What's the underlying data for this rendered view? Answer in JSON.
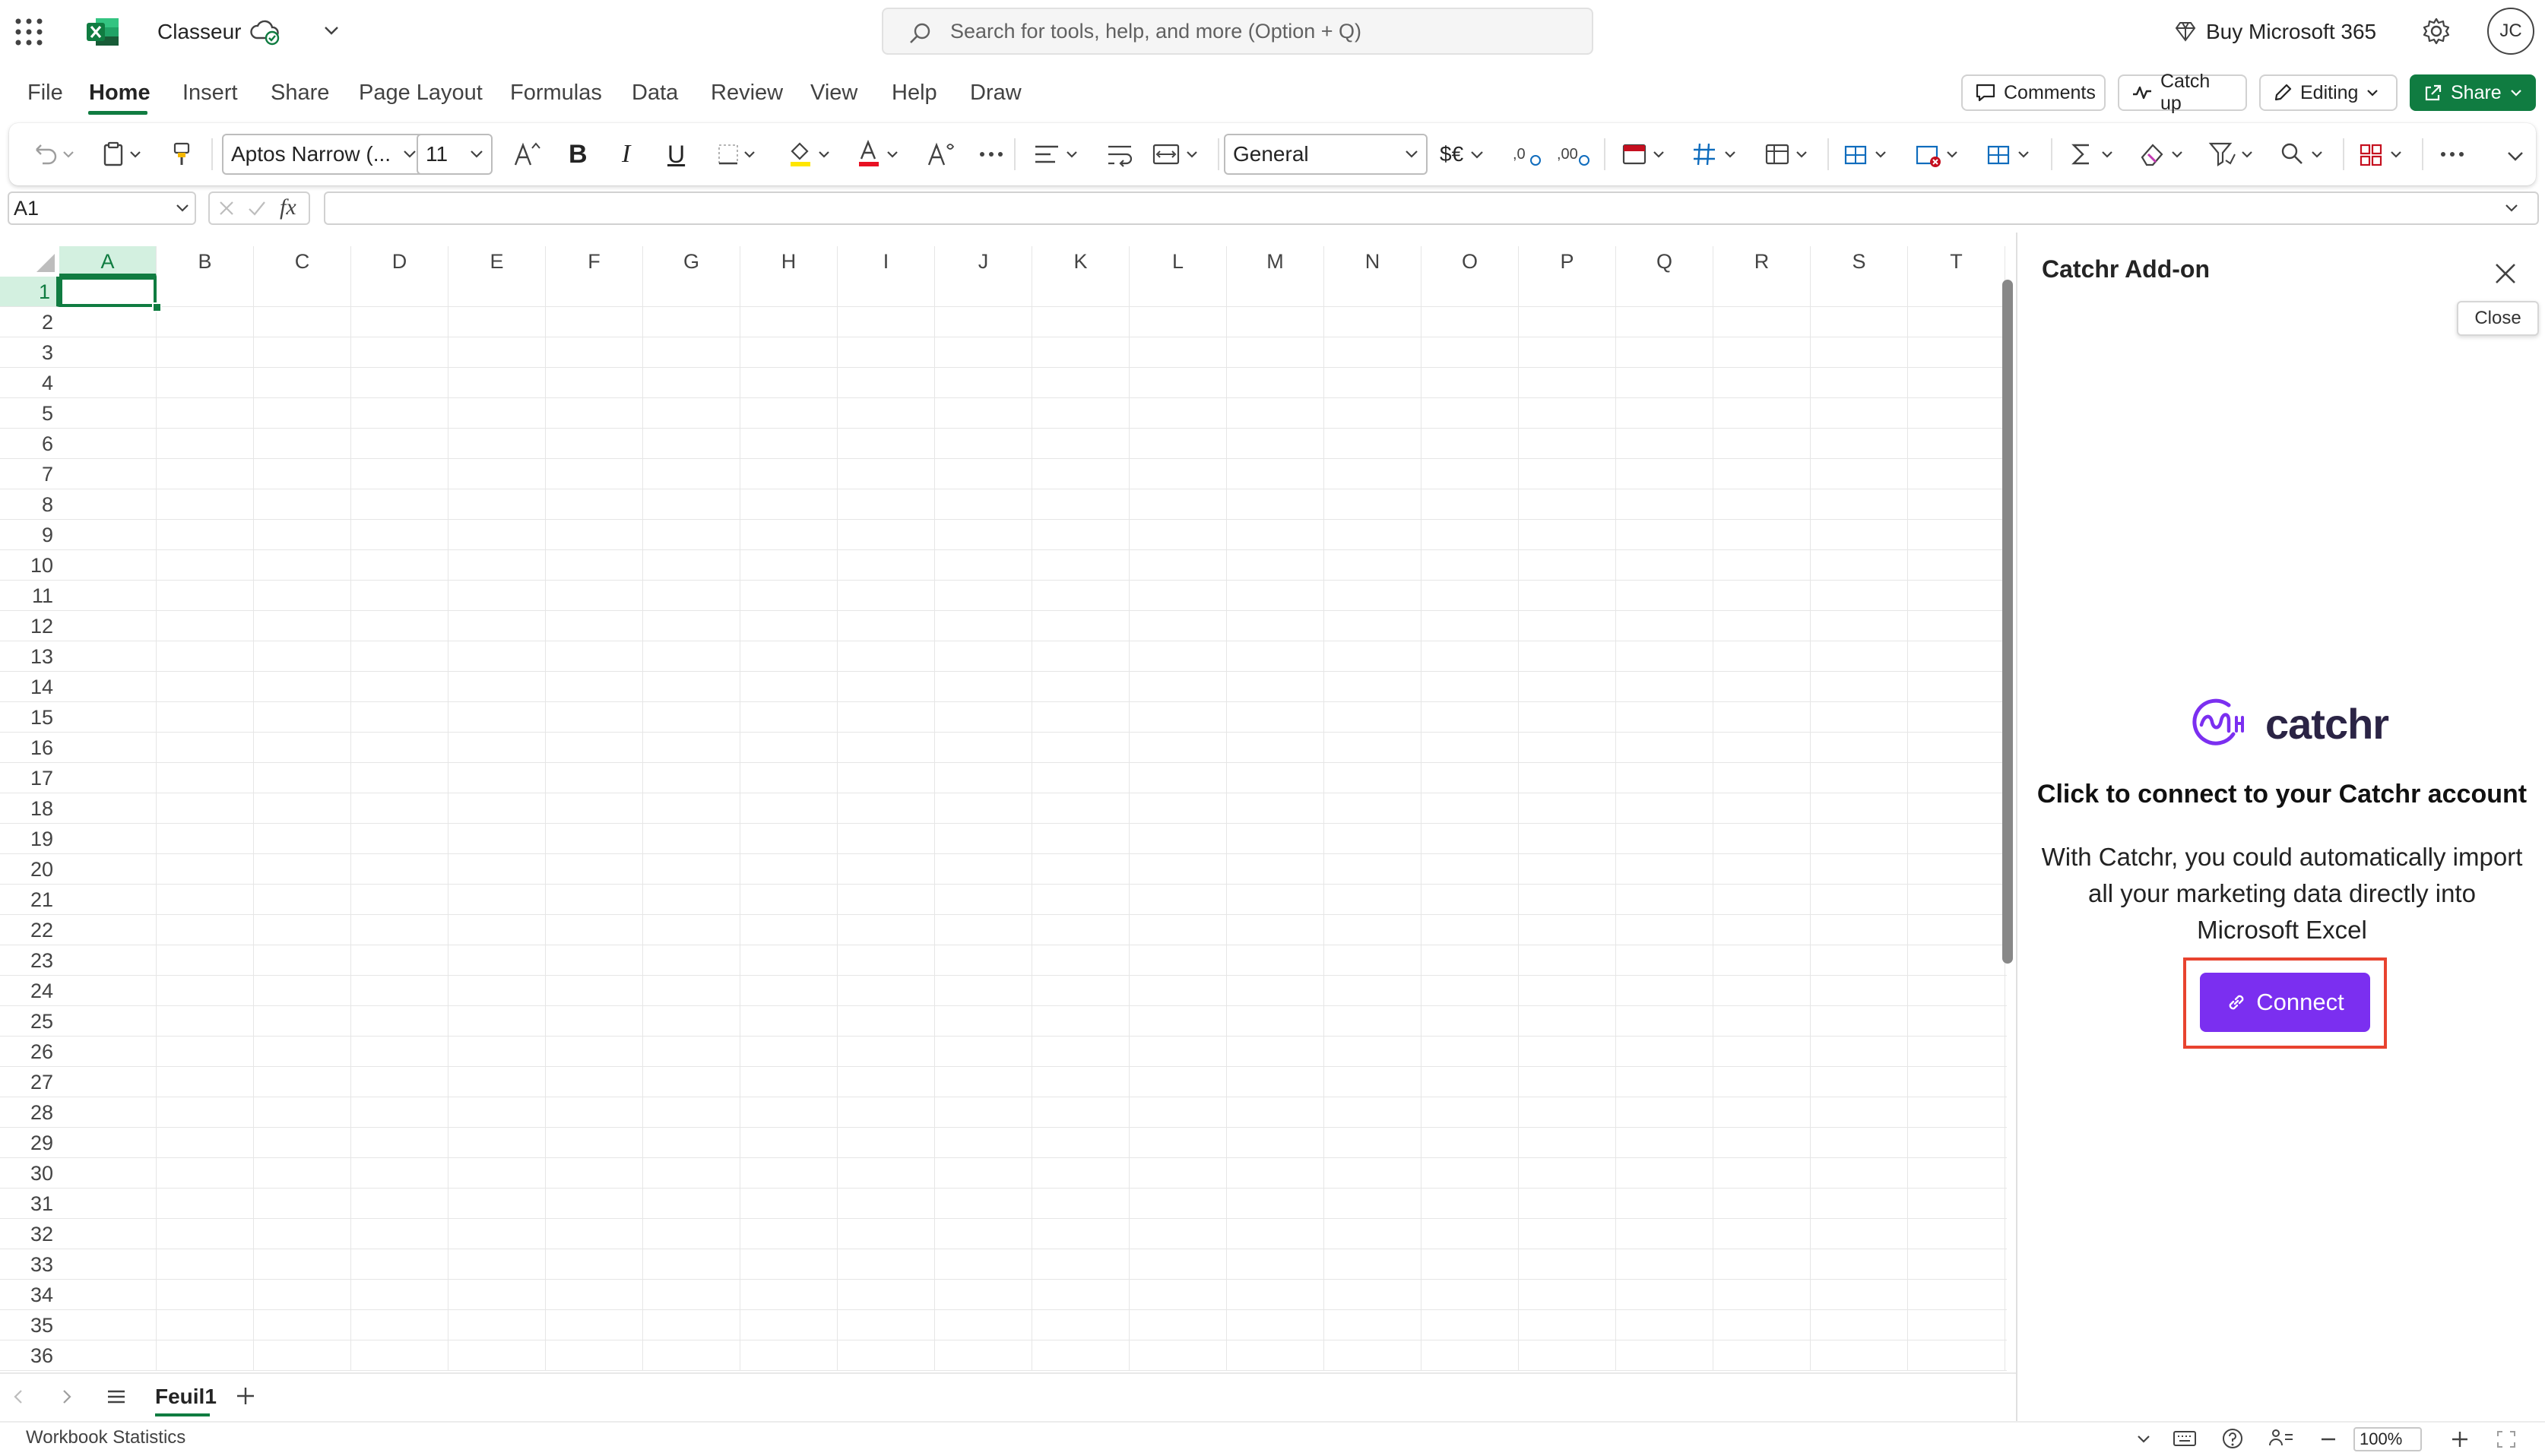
{
  "app": {
    "doc_title": "Classeur",
    "search_placeholder": "Search for tools, help, and more (Option + Q)",
    "buy_label": "Buy Microsoft 365",
    "avatar_initials": "JC",
    "accent_color": "#107c41"
  },
  "tabs": [
    "File",
    "Home",
    "Insert",
    "Share",
    "Page Layout",
    "Formulas",
    "Data",
    "Review",
    "View",
    "Help",
    "Draw"
  ],
  "active_tab": "Home",
  "actions": {
    "comments": "Comments",
    "catch_up": "Catch up",
    "editing": "Editing",
    "share": "Share"
  },
  "ribbon": {
    "font_name": "Aptos Narrow (...",
    "font_size": "11",
    "number_format": "General",
    "currency_symbol": "$€"
  },
  "formula_bar": {
    "name_box": "A1",
    "formula": ""
  },
  "grid": {
    "columns": [
      "A",
      "B",
      "C",
      "D",
      "E",
      "F",
      "G",
      "H",
      "I",
      "J",
      "K",
      "L",
      "M",
      "N",
      "O",
      "P",
      "Q",
      "R",
      "S",
      "T"
    ],
    "rows": [
      "1",
      "2",
      "3",
      "4",
      "5",
      "6",
      "7",
      "8",
      "9",
      "10",
      "11",
      "12",
      "13",
      "14",
      "15",
      "16",
      "17",
      "18",
      "19",
      "20",
      "21",
      "22",
      "23",
      "24",
      "25",
      "26",
      "27",
      "28",
      "29",
      "30",
      "31",
      "32",
      "33",
      "34",
      "35",
      "36"
    ],
    "selected_cell": "A1"
  },
  "sheets": {
    "active": "Feuil1"
  },
  "status": {
    "left_text": "Workbook Statistics",
    "zoom": "100%"
  },
  "pane": {
    "title": "Catchr Add-on",
    "close_tooltip": "Close",
    "brand": "catchr",
    "heading": "Click to connect to your Catchr account",
    "description": "With Catchr, you could automatically import all your marketing data directly into Microsoft Excel",
    "connect_label": "Connect",
    "brand_color": "#7b2ff0"
  }
}
